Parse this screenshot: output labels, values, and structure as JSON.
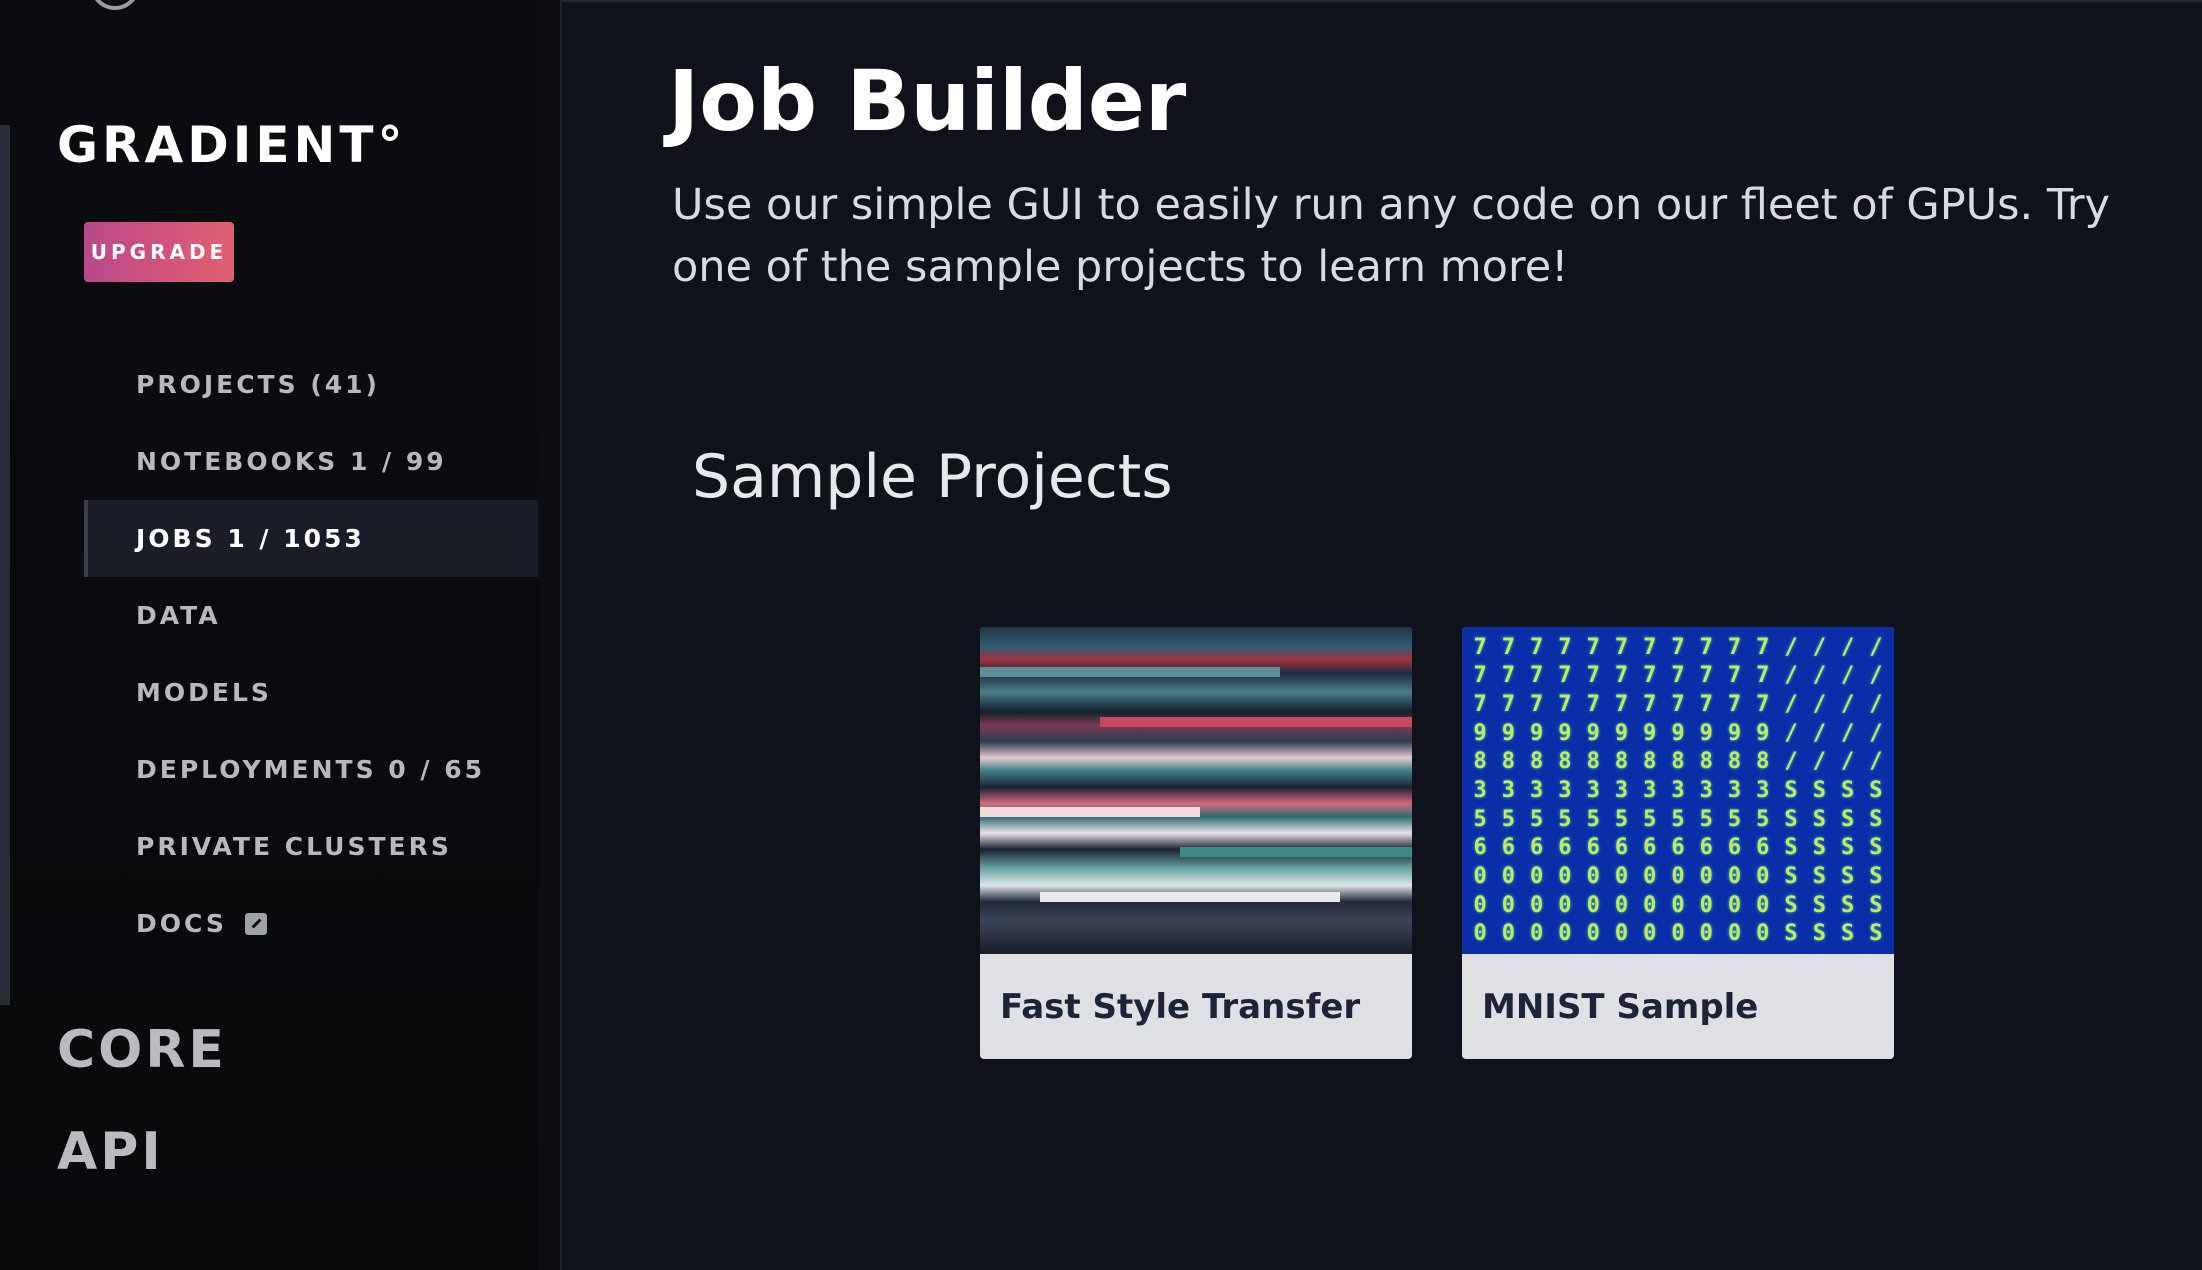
{
  "sidebar": {
    "brand": "GRADIENT°",
    "upgrade_label": "UPGRADE",
    "items": [
      {
        "label": "PROJECTS (41)"
      },
      {
        "label": "NOTEBOOKS 1 / 99"
      },
      {
        "label": "JOBS 1 / 1053",
        "active": true
      },
      {
        "label": "DATA"
      },
      {
        "label": "MODELS"
      },
      {
        "label": "DEPLOYMENTS 0 / 65"
      },
      {
        "label": "PRIVATE CLUSTERS"
      },
      {
        "label": "DOCS",
        "icon": "external-link-icon"
      }
    ],
    "sections": {
      "core": "CORE",
      "api": "API"
    }
  },
  "main": {
    "title": "Job Builder",
    "subtitle": "Use our simple GUI to easily run any code on our fleet of GPUs. Try one of the sample projects to learn more!",
    "sample_heading": "Sample Projects",
    "cards": [
      {
        "label": "Fast Style Transfer"
      },
      {
        "label": "MNIST Sample"
      }
    ]
  },
  "colors": {
    "background": "#0f121a",
    "sidebar": "#0b0c10",
    "upgrade_gradient_start": "#b84a8a",
    "upgrade_gradient_end": "#e06270",
    "card_background": "#dfe0e3",
    "card_text": "#1c2538",
    "mnist_background": "#0a2da8"
  }
}
